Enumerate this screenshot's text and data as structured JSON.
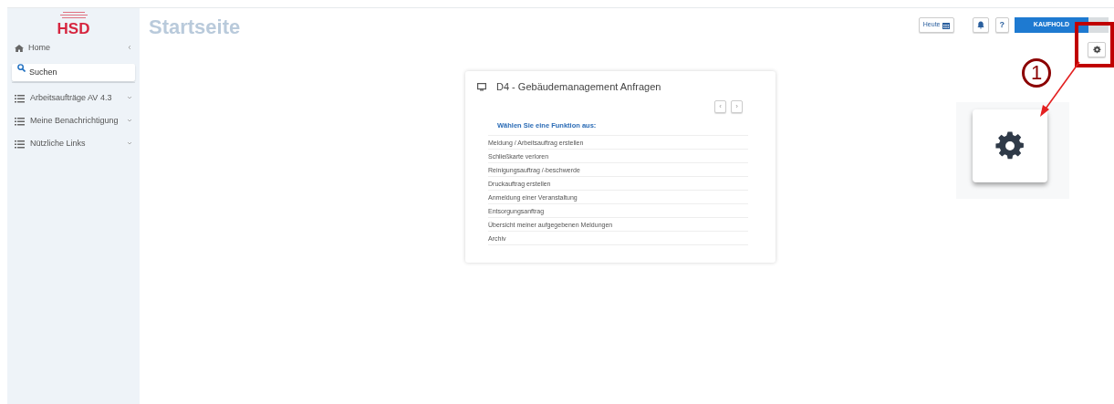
{
  "sidebar": {
    "logo": "HSD",
    "home": {
      "label": "Home"
    },
    "search": {
      "placeholder": "Suchen"
    },
    "groups": [
      {
        "label": "Arbeitsaufträge AV 4.3"
      },
      {
        "label": "Meine Benachrichtigung"
      },
      {
        "label": "Nützliche Links"
      }
    ]
  },
  "page_title": "Startseite",
  "toolbar": {
    "today": "Heute",
    "help": "?",
    "user": "KAUFHOLD"
  },
  "card": {
    "title": "D4 - Gebäudemanagement Anfragen",
    "prev": "‹",
    "next": "›",
    "heading": "Wählen Sie eine Funktion aus:",
    "items": [
      "Meldung / Arbeitsauftrag erstellen",
      "Schließkarte verloren",
      "Reinigungsauftrag /-beschwerde",
      "Druckauftrag erstellen",
      "Anmeldung einer Veranstaltung",
      "Entsorgungsanftrag",
      "Übersicht meiner aufgegebenen Meldungen",
      "Archiv"
    ]
  },
  "annotation": {
    "number": "1"
  }
}
